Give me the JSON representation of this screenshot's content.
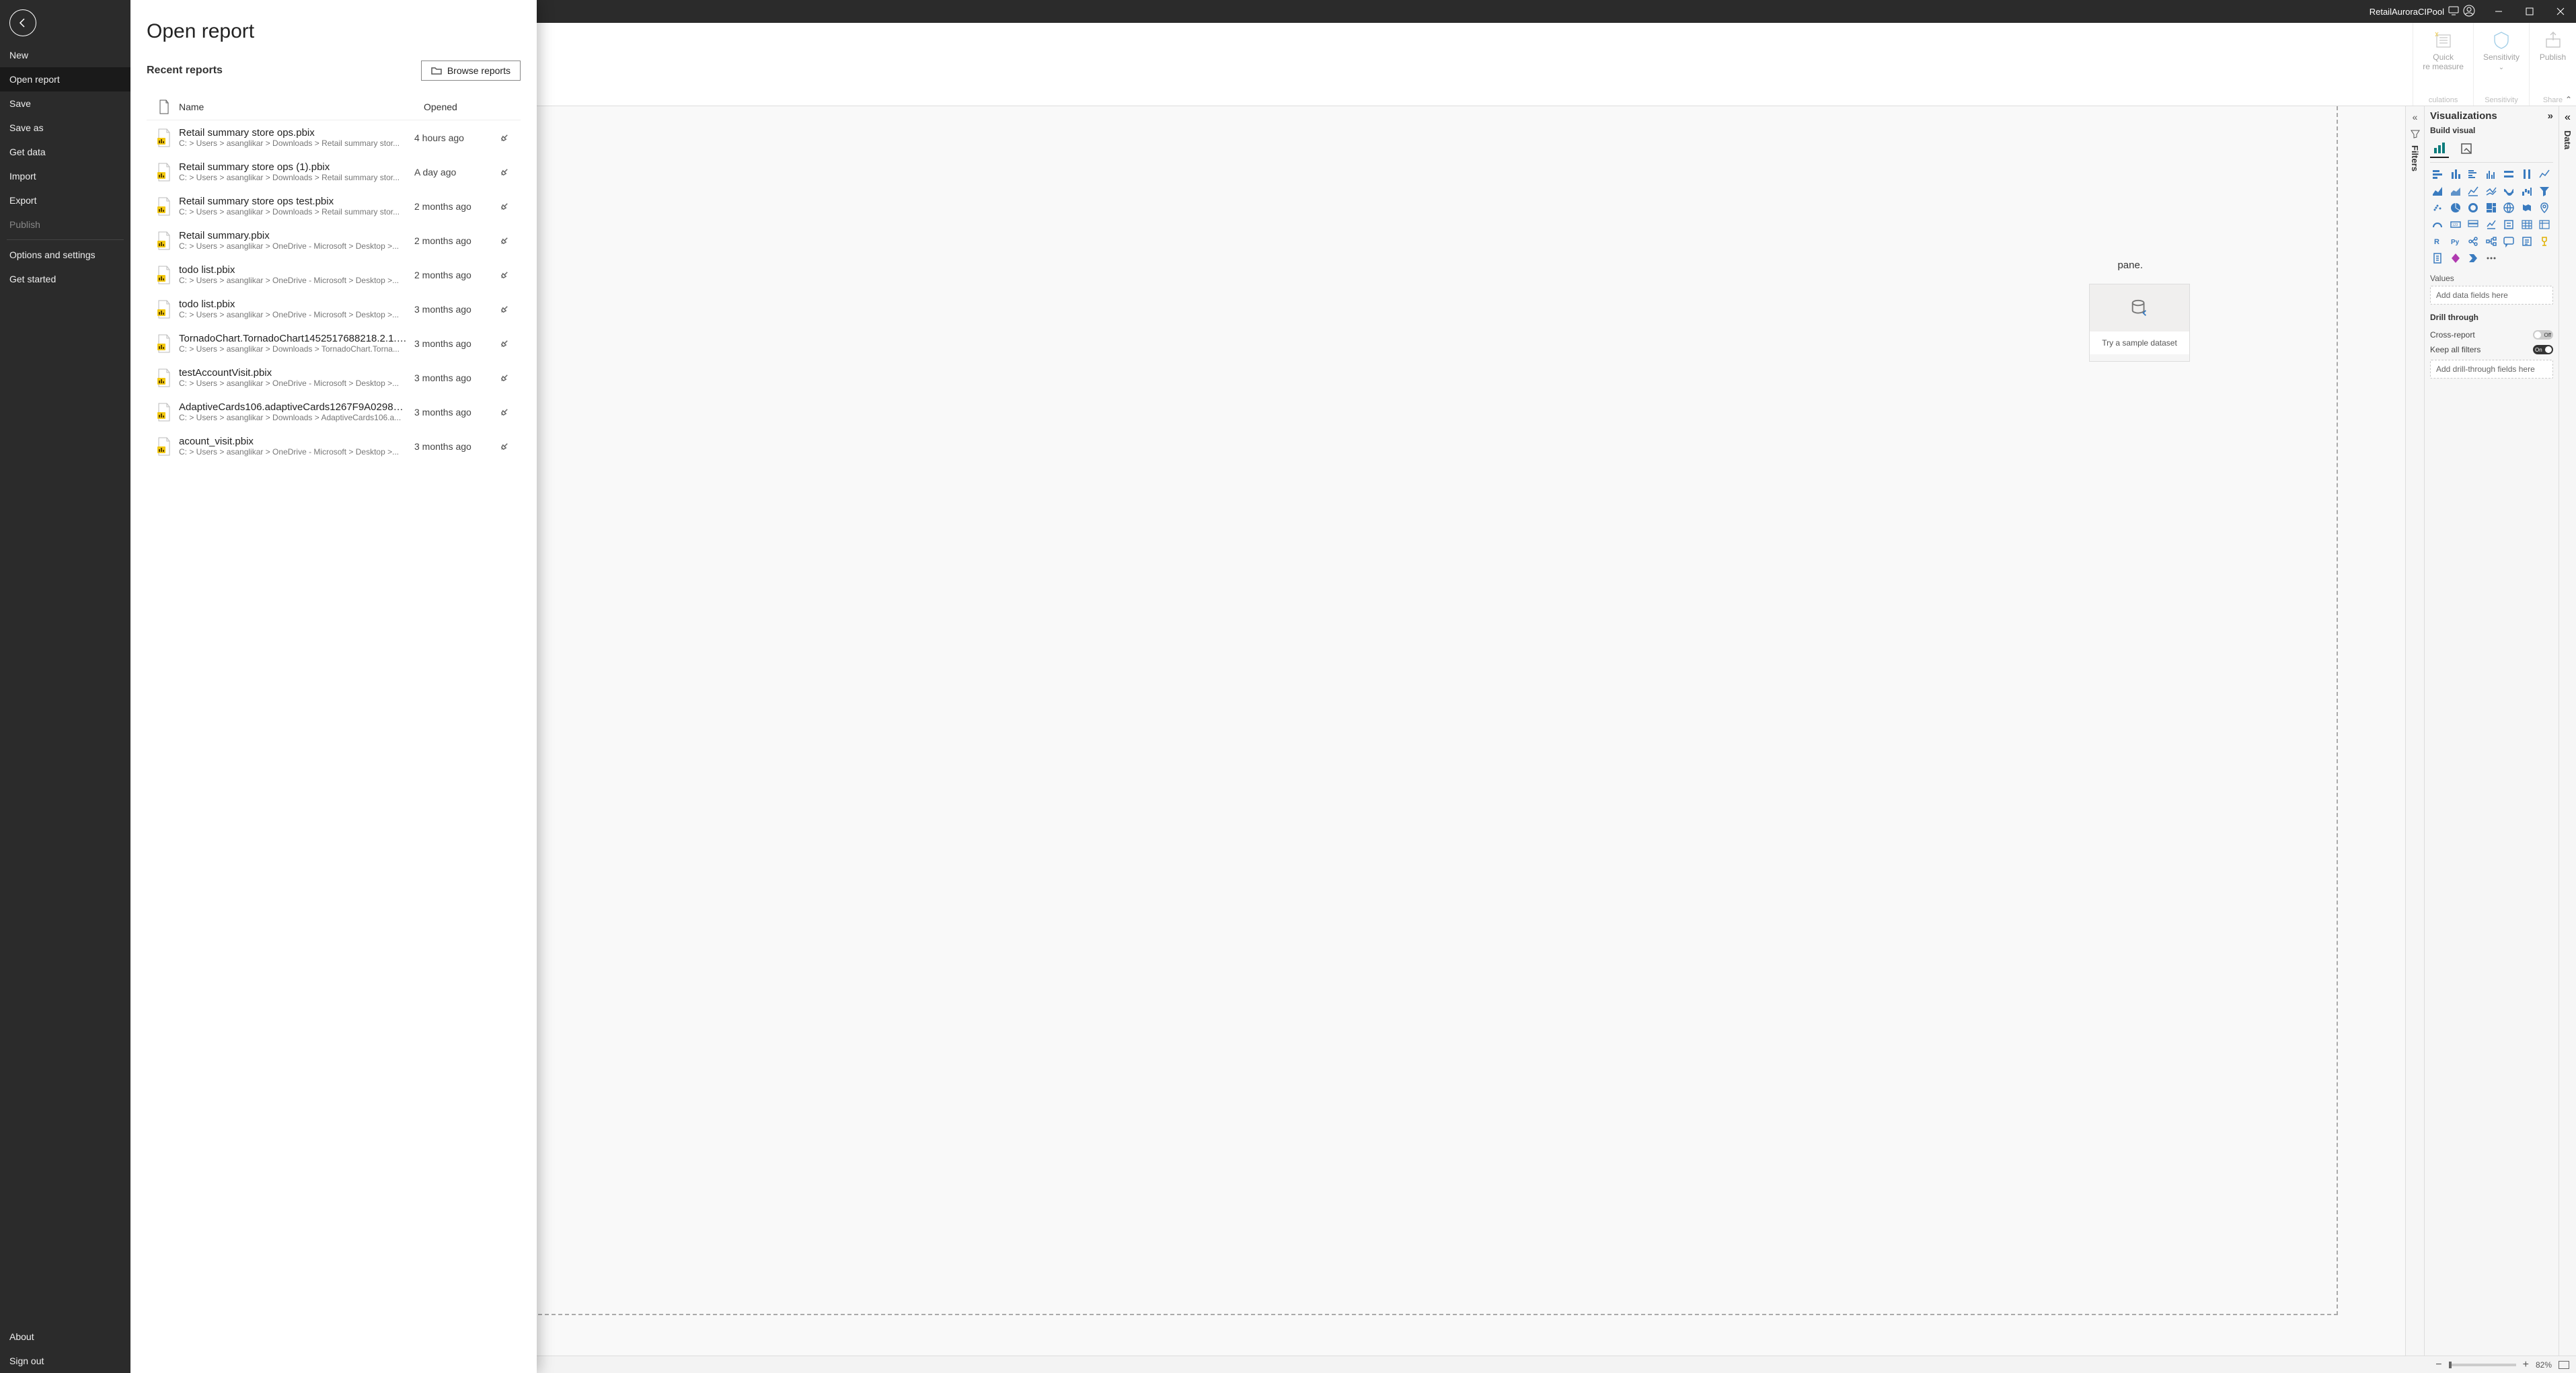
{
  "titlebar": {
    "account_name": "RetailAuroraCIPool"
  },
  "ribbon": {
    "groups": [
      {
        "label_line1": "Quick",
        "label_line2": "re measure",
        "group": "culations"
      },
      {
        "label_line1": "Sensitivity",
        "label_line2": "",
        "group": "Sensitivity"
      },
      {
        "label_line1": "Publish",
        "label_line2": "",
        "group": "Share"
      }
    ]
  },
  "canvas": {
    "hint_suffix": "pane.",
    "sample_card_label": "Try a sample dataset"
  },
  "panes": {
    "filters_label": "Filters",
    "data_label": "Data",
    "viz": {
      "title": "Visualizations",
      "subtitle": "Build visual",
      "values_label": "Values",
      "values_placeholder": "Add data fields here",
      "drill_label": "Drill through",
      "crossreport_label": "Cross-report",
      "crossreport_state": "Off",
      "keepfilters_label": "Keep all filters",
      "keepfilters_state": "On",
      "drill_placeholder": "Add drill-through fields here"
    }
  },
  "statusbar": {
    "zoom_pct": "82%"
  },
  "filemenu": {
    "items": [
      {
        "label": "New",
        "state": ""
      },
      {
        "label": "Open report",
        "state": "active"
      },
      {
        "label": "Save",
        "state": ""
      },
      {
        "label": "Save as",
        "state": ""
      },
      {
        "label": "Get data",
        "state": ""
      },
      {
        "label": "Import",
        "state": ""
      },
      {
        "label": "Export",
        "state": ""
      },
      {
        "label": "Publish",
        "state": "disabled"
      },
      {
        "label": "Options and settings",
        "state": ""
      },
      {
        "label": "Get started",
        "state": ""
      }
    ],
    "footer": [
      {
        "label": "About"
      },
      {
        "label": "Sign out"
      }
    ]
  },
  "openpanel": {
    "title": "Open report",
    "recent_heading": "Recent reports",
    "browse_label": "Browse reports",
    "col_name": "Name",
    "col_opened": "Opened",
    "files": [
      {
        "name": "Retail summary store ops.pbix",
        "path": "C: > Users > asanglikar > Downloads > Retail summary stor...",
        "opened": "4 hours ago"
      },
      {
        "name": "Retail summary store ops (1).pbix",
        "path": "C: > Users > asanglikar > Downloads > Retail summary stor...",
        "opened": "A day ago"
      },
      {
        "name": "Retail summary store ops test.pbix",
        "path": "C: > Users > asanglikar > Downloads > Retail summary stor...",
        "opened": "2 months ago"
      },
      {
        "name": "Retail summary.pbix",
        "path": "C: > Users > asanglikar > OneDrive - Microsoft > Desktop >...",
        "opened": "2 months ago"
      },
      {
        "name": "todo list.pbix",
        "path": "C: > Users > asanglikar > OneDrive - Microsoft > Desktop >...",
        "opened": "2 months ago"
      },
      {
        "name": "todo list.pbix",
        "path": "C: > Users > asanglikar > OneDrive - Microsoft > Desktop >...",
        "opened": "3 months ago"
      },
      {
        "name": "TornadoChart.TornadoChart1452517688218.2.1.0.0....",
        "path": "C: > Users > asanglikar > Downloads > TornadoChart.Torna...",
        "opened": "3 months ago"
      },
      {
        "name": "testAccountVisit.pbix",
        "path": "C: > Users > asanglikar > OneDrive - Microsoft > Desktop >...",
        "opened": "3 months ago"
      },
      {
        "name": "AdaptiveCards106.adaptiveCards1267F9A0298D43....",
        "path": "C: > Users > asanglikar > Downloads > AdaptiveCards106.a...",
        "opened": "3 months ago"
      },
      {
        "name": "acount_visit.pbix",
        "path": "C: > Users > asanglikar > OneDrive - Microsoft > Desktop >...",
        "opened": "3 months ago"
      }
    ]
  }
}
